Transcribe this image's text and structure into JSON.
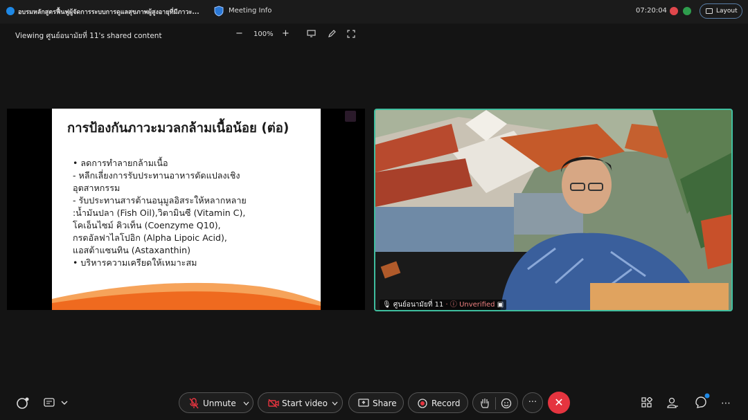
{
  "window": {
    "app_title": "อบรมหลักสูตรฟื้นฟูผู้จัดการระบบการดูแลสุขภาพผู้สูงอายุที่มีภาวะ...",
    "meeting_info_label": "Meeting Info",
    "time": "07:20:04",
    "layout_label": "Layout"
  },
  "viewer": {
    "viewing_label": "Viewing ศูนย์อนามัยที่ 11's shared content",
    "zoom_minus": "−",
    "zoom_level": "100%",
    "zoom_plus": "+"
  },
  "slide": {
    "title": "การป้องกันภาวะมวลกล้ามเนื้อน้อย (ต่อ)",
    "lines": [
      "•   ลดการทำลายกล้ามเนื้อ",
      "      - หลีกเลี่ยงการรับประทานอาหารดัดแปลงเชิง",
      "อุตสาหกรรม",
      "      - รับประทานสารต้านอนุมูลอิสระให้หลากหลาย",
      ":น้ำมันปลา (Fish Oil),วิตามินซี (Vitamin C),",
      "โคเอ็นไซม์ คิวเท็น (Coenzyme Q10),",
      "กรดอัลฟาไลโปอิก (Alpha Lipoic Acid),",
      "แอสต้าแซนทิน (Astaxanthin)",
      "•   บริหารความเครียดให้เหมาะสม"
    ]
  },
  "video": {
    "participant_name": "ศูนย์อนามัยที่ 11",
    "status": "Unverified"
  },
  "controls": {
    "unmute": "Unmute",
    "start_video": "Start video",
    "share": "Share",
    "record": "Record",
    "more": "···",
    "end": "✕"
  },
  "icons": {
    "mute": "mic-off-icon",
    "video": "video-off-icon",
    "share": "share-screen-icon",
    "record": "record-icon",
    "raise_hand": "hand-icon",
    "reactions": "emoji-icon",
    "apps": "apps-icon",
    "participants": "participants-icon",
    "chat": "chat-icon"
  },
  "colors": {
    "accent_teal": "#3fbf9f",
    "end_red": "#e5343f",
    "unverified": "#f08080"
  }
}
